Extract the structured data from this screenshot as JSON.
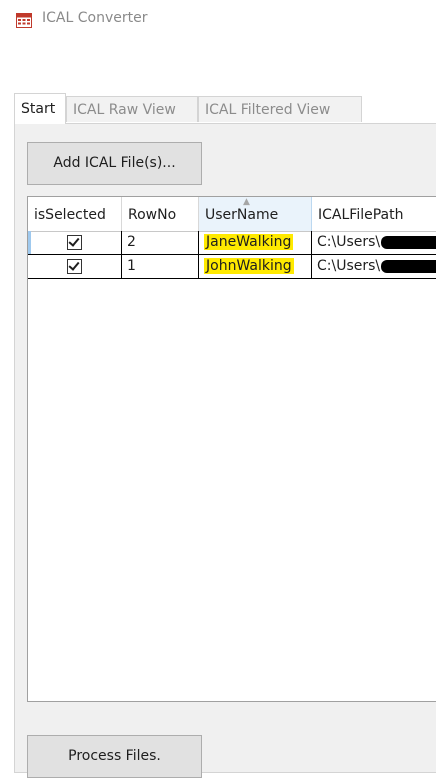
{
  "window": {
    "title": "ICAL Converter",
    "icon": "calendar-icon"
  },
  "tabs": [
    {
      "label": "Start",
      "active": true
    },
    {
      "label": "ICAL Raw View",
      "active": false
    },
    {
      "label": "ICAL Filtered View",
      "active": false
    }
  ],
  "start_tab": {
    "add_button_label": "Add ICAL File(s)...",
    "process_button_label": "Process Files.",
    "grid": {
      "columns": [
        "isSelected",
        "RowNo",
        "UserName",
        "ICALFilePath"
      ],
      "sorted_column": "UserName",
      "sort_direction": "ascending",
      "rows": [
        {
          "isSelected": true,
          "RowNo": "2",
          "UserName": "JaneWalking",
          "ICALFilePath": "C:\\Users\\"
        },
        {
          "isSelected": true,
          "RowNo": "1",
          "UserName": "JohnWalking",
          "ICALFilePath": "C:\\Users\\"
        }
      ]
    }
  },
  "colors": {
    "highlight": "#ffea00",
    "panel_bg": "#f0f0f0",
    "button_bg": "#e1e1e1"
  }
}
